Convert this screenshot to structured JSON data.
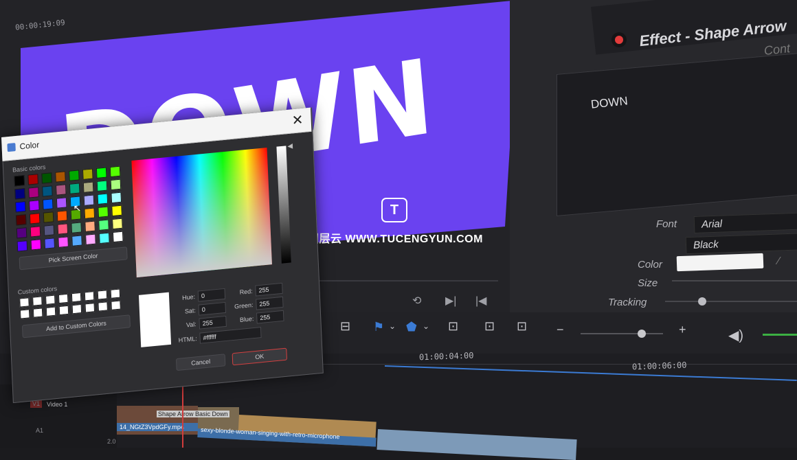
{
  "viewer": {
    "timecode": "00:00:19:09",
    "preview_text": "DOWN",
    "preview_bg": "#6a42f0"
  },
  "watermark": {
    "logo": "T",
    "text": "图层云 WWW.TUCENGYUN.COM"
  },
  "inspector": {
    "title": "Effect - Shape Arrow",
    "tab": "Cont",
    "text_value": "DOWN",
    "font_label": "Font",
    "font_value": "Arial",
    "style_value": "Black",
    "color_label": "Color",
    "color_value": "#f4f4f4",
    "size_label": "Size",
    "tracking_label": "Tracking"
  },
  "timeline": {
    "tc1": "01:00:04:00",
    "tc2": "01:00:06:00",
    "track_v1": "V1",
    "track_v1_name": "Video 1",
    "track_a1": "A1",
    "track_num": "2.0",
    "clip1_label": "14_NGtZ3VpdGFy.mp4",
    "clip1_title": "Shape Arrow Basic Down",
    "clip2_label": "sexy-blonde-woman-singing-with-retro-microphone"
  },
  "color_dialog": {
    "title": "Color",
    "basic_colors_label": "Basic colors",
    "pick_screen_label": "Pick Screen Color",
    "custom_colors_label": "Custom colors",
    "add_custom_label": "Add to Custom Colors",
    "hue_label": "Hue:",
    "hue": "0",
    "sat_label": "Sat:",
    "sat": "0",
    "val_label": "Val:",
    "val": "255",
    "red_label": "Red:",
    "red": "255",
    "green_label": "Green:",
    "green": "255",
    "blue_label": "Blue:",
    "blue": "255",
    "html_label": "HTML:",
    "html": "#ffffff",
    "cancel_label": "Cancel",
    "ok_label": "OK",
    "basic_colors": [
      "#000000",
      "#aa0000",
      "#005500",
      "#aa5500",
      "#00aa00",
      "#aaaa00",
      "#00ff00",
      "#55ff00",
      "#00007f",
      "#aa007f",
      "#00557f",
      "#aa557f",
      "#00aa7f",
      "#aaaa7f",
      "#00ff7f",
      "#aaff7f",
      "#0000ff",
      "#aa00ff",
      "#0055ff",
      "#aa55ff",
      "#00aaff",
      "#aaaaff",
      "#00ffff",
      "#aaffff",
      "#550000",
      "#ff0000",
      "#555500",
      "#ff5500",
      "#55aa00",
      "#ffaa00",
      "#55ff00",
      "#ffff00",
      "#55007f",
      "#ff007f",
      "#55557f",
      "#ff557f",
      "#55aa7f",
      "#ffaa7f",
      "#55ff7f",
      "#ffff7f",
      "#5500ff",
      "#ff00ff",
      "#5555ff",
      "#ff55ff",
      "#55aaff",
      "#ffaaff",
      "#55ffff",
      "#ffffff"
    ]
  }
}
